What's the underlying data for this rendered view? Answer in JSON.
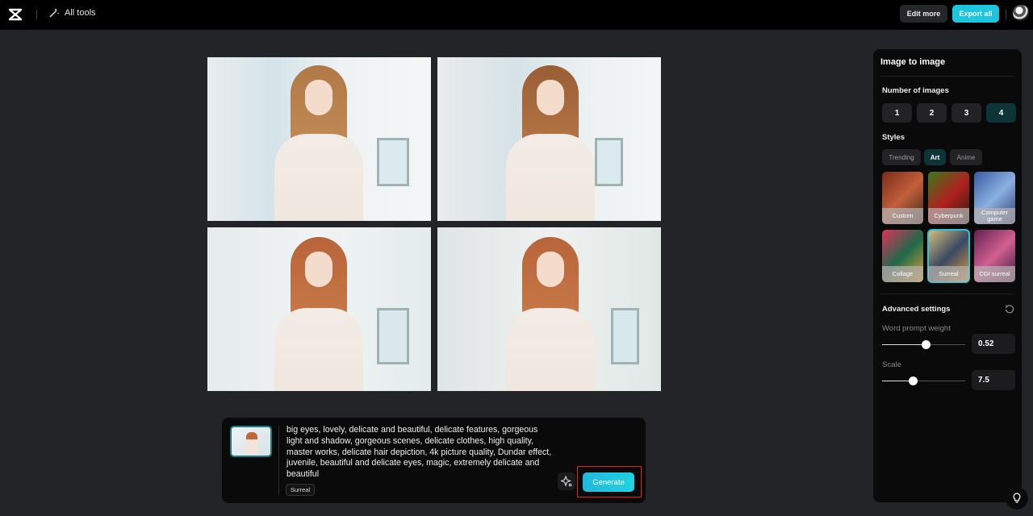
{
  "header": {
    "logo": "capcut-logo-icon",
    "all_tools_label": "All tools",
    "edit_more_label": "Edit more",
    "export_all_label": "Export all"
  },
  "results": {
    "images": [
      {
        "label": "generated-image-1"
      },
      {
        "label": "generated-image-2"
      },
      {
        "label": "generated-image-3"
      },
      {
        "label": "generated-image-4"
      }
    ]
  },
  "prompt": {
    "text": "big eyes, lovely, delicate and beautiful, delicate features, gorgeous light and shadow, gorgeous scenes, delicate clothes, high quality, master works, delicate hair depiction, 4k picture quality, Dundar effect, juvenile, beautiful and delicate eyes, magic, extremely delicate and beautiful",
    "style_tag": "Surreal",
    "generate_label": "Generate"
  },
  "panel": {
    "title": "Image to image",
    "number_label": "Number of images",
    "numbers": [
      "1",
      "2",
      "3",
      "4"
    ],
    "selected_number": "4",
    "styles_label": "Styles",
    "style_tabs": [
      "Trending",
      "Art",
      "Anime"
    ],
    "selected_tab": "Art",
    "style_cards": [
      "Custom",
      "Cyberpunk",
      "Computer game",
      "Collage",
      "Surreal",
      "CGI surreal"
    ],
    "selected_style": "Surreal",
    "advanced_label": "Advanced settings",
    "word_weight_label": "Word prompt weight",
    "word_weight_value": "0.52",
    "word_weight_fraction": 0.52,
    "scale_label": "Scale",
    "scale_value": "7.5",
    "scale_fraction": 0.37
  },
  "colors": {
    "accent": "#1cc6de",
    "selected_bg": "#0d3537",
    "highlight_box": "#e0222a"
  }
}
